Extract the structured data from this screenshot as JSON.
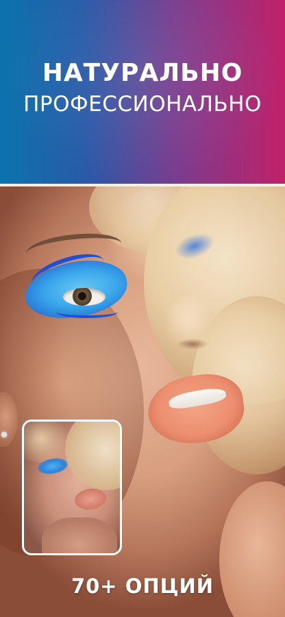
{
  "banner": {
    "headline_primary": "НАТУРАЛЬНО",
    "headline_secondary": "ПРОФЕССИОНАЛЬНО",
    "gradient_colors": [
      "#0b73ad",
      "#2a5aa8",
      "#7a3c8d",
      "#c0216a"
    ]
  },
  "photo": {
    "main_image": "woman-with-blue-eye-makeup",
    "before_thumbnail": "before-makeup-thumbnail"
  },
  "footer": {
    "options_count_label": "70+ ОПЦИЙ"
  }
}
